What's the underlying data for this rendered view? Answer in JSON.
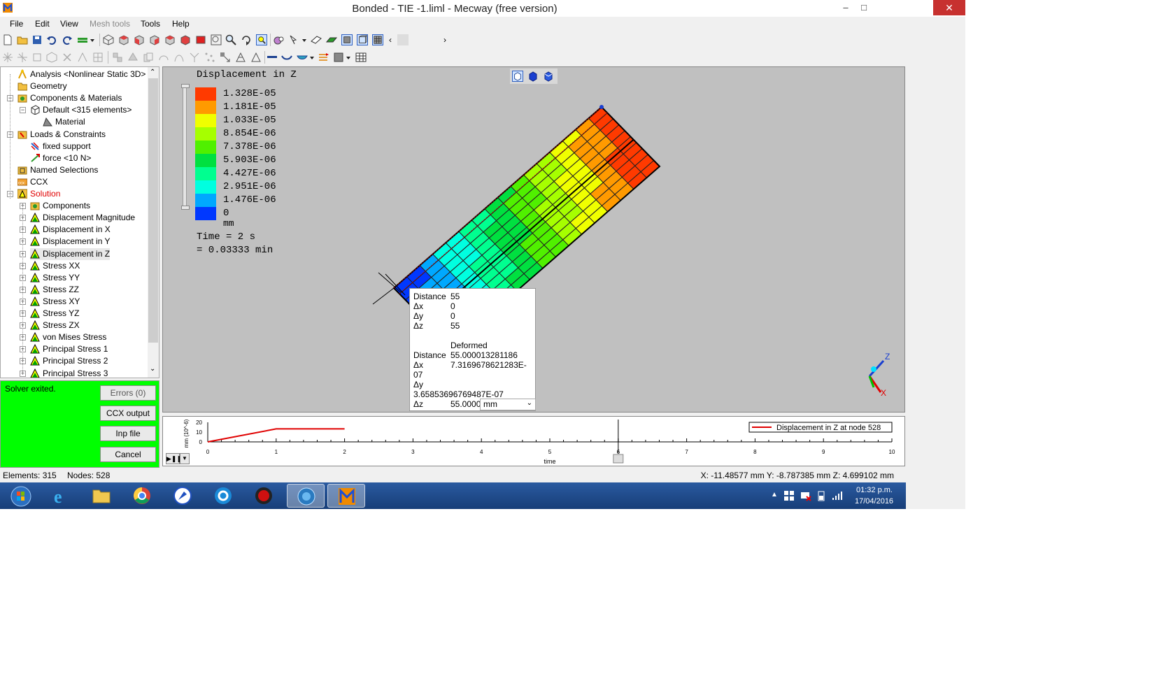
{
  "window": {
    "title": "Bonded - TIE -1.liml - Mecway (free version)",
    "controls": {
      "minimize": "–",
      "maximize": "□",
      "close": "✕"
    }
  },
  "menu": [
    {
      "label": "File",
      "enabled": true
    },
    {
      "label": "Edit",
      "enabled": true
    },
    {
      "label": "View",
      "enabled": true
    },
    {
      "label": "Mesh tools",
      "enabled": false
    },
    {
      "label": "Tools",
      "enabled": true
    },
    {
      "label": "Help",
      "enabled": true
    }
  ],
  "tree": {
    "items": [
      {
        "label": "Analysis <Nonlinear Static 3D>",
        "icon": "analysis-icon",
        "color": "#000"
      },
      {
        "label": "Geometry",
        "icon": "folder-icon",
        "color": "#000"
      },
      {
        "label": "Components & Materials",
        "icon": "components-icon",
        "color": "#000"
      },
      {
        "label": "Default <315 elements>",
        "icon": "mesh-icon",
        "color": "#000"
      },
      {
        "label": "Material",
        "icon": "material-icon",
        "color": "#000"
      },
      {
        "label": "Loads & Constraints",
        "icon": "loads-icon",
        "color": "#000"
      },
      {
        "label": "fixed support",
        "icon": "fixed-support-icon",
        "color": "#000"
      },
      {
        "label": "force <10 N>",
        "icon": "force-icon",
        "color": "#000"
      },
      {
        "label": "Named Selections",
        "icon": "named-selections-icon",
        "color": "#000"
      },
      {
        "label": "CCX",
        "icon": "ccx-icon",
        "color": "#000"
      },
      {
        "label": "Solution",
        "icon": "solution-icon",
        "color": "#e00000"
      },
      {
        "label": "Components",
        "icon": "components-icon",
        "color": "#000"
      },
      {
        "label": "Displacement Magnitude",
        "icon": "result-icon",
        "color": "#000"
      },
      {
        "label": "Displacement in X",
        "icon": "result-icon",
        "color": "#000"
      },
      {
        "label": "Displacement in Y",
        "icon": "result-icon",
        "color": "#000"
      },
      {
        "label": "Displacement in Z",
        "icon": "result-icon",
        "color": "#000"
      },
      {
        "label": "Stress XX",
        "icon": "result-icon",
        "color": "#000"
      },
      {
        "label": "Stress YY",
        "icon": "result-icon",
        "color": "#000"
      },
      {
        "label": "Stress ZZ",
        "icon": "result-icon",
        "color": "#000"
      },
      {
        "label": "Stress XY",
        "icon": "result-icon",
        "color": "#000"
      },
      {
        "label": "Stress YZ",
        "icon": "result-icon",
        "color": "#000"
      },
      {
        "label": "Stress ZX",
        "icon": "result-icon",
        "color": "#000"
      },
      {
        "label": "von Mises Stress",
        "icon": "result-icon",
        "color": "#000"
      },
      {
        "label": "Principal Stress 1",
        "icon": "result-icon",
        "color": "#000"
      },
      {
        "label": "Principal Stress 2",
        "icon": "result-icon",
        "color": "#000"
      },
      {
        "label": "Principal Stress 3",
        "icon": "result-icon",
        "color": "#000"
      }
    ]
  },
  "solver": {
    "status": "Solver exited.",
    "buttons": {
      "errors": "Errors (0)",
      "ccx_output": "CCX output",
      "inp_file": "Inp file",
      "cancel": "Cancel"
    }
  },
  "legend": {
    "title": "Displacement in Z",
    "levels": [
      {
        "label": "1.328E-05",
        "color": "#ff3a00"
      },
      {
        "label": "1.181E-05",
        "color": "#ff9a00"
      },
      {
        "label": "1.033E-05",
        "color": "#f0ff00"
      },
      {
        "label": "8.854E-06",
        "color": "#a6ff00"
      },
      {
        "label": "7.378E-06",
        "color": "#50f000"
      },
      {
        "label": "5.903E-06",
        "color": "#00e040"
      },
      {
        "label": "4.427E-06",
        "color": "#00ff90"
      },
      {
        "label": "2.951E-06",
        "color": "#00ffe0"
      },
      {
        "label": "1.476E-06",
        "color": "#00a8ff"
      },
      {
        "label": "0",
        "color": "#0038ff"
      }
    ],
    "unit": "mm",
    "time_line1": "Time = 2 s",
    "time_line2": "= 0.03333 min"
  },
  "tooltip": {
    "rows": [
      {
        "k": "Distance",
        "v": "55"
      },
      {
        "k": "Δx",
        "v": "0"
      },
      {
        "k": "Δy",
        "v": "0"
      },
      {
        "k": "Δz",
        "v": "55"
      },
      {
        "k": "",
        "v": "Deformed"
      },
      {
        "k": "Distance",
        "v": "55.000013281186"
      },
      {
        "k": "Δx",
        "v": "7.3169678621283E-"
      },
      {
        "k": "07",
        "v": ""
      },
      {
        "k": "Δy",
        "v": ""
      },
      {
        "k": "3.65853696769487E-07",
        "v": ""
      },
      {
        "k": "Δz",
        "v": "55.0000"
      }
    ],
    "unit": "mm"
  },
  "axes_triad": {
    "z": "Z",
    "x": "X"
  },
  "graph": {
    "legend": "Displacement in Z at node 528",
    "ylabel": "mm (10^-6)",
    "xlabel": "time",
    "y_ticks": [
      "20",
      "10",
      "0"
    ],
    "x_ticks": [
      "0",
      "1",
      "2",
      "3",
      "4",
      "5",
      "6",
      "7",
      "8",
      "9",
      "10"
    ],
    "line_color": "#e00000",
    "time_cursor": 6
  },
  "chart_data": {
    "type": "line",
    "title": "",
    "xlabel": "time",
    "ylabel": "mm (10^-6)",
    "xlim": [
      0,
      10
    ],
    "ylim": [
      0,
      20
    ],
    "series": [
      {
        "name": "Displacement in Z at node 528",
        "x": [
          0,
          1,
          2
        ],
        "y": [
          0,
          13.28,
          13.28
        ]
      }
    ]
  },
  "status": {
    "elements": "Elements: 315",
    "nodes": "Nodes: 528",
    "coords": "X: -11.48577 mm Y: -8.787385 mm Z: 4.699102 mm"
  },
  "taskbar": {
    "apps": [
      "start",
      "internet-explorer",
      "file-explorer",
      "chrome",
      "app-blue",
      "app-c",
      "app-red",
      "app-globe",
      "mecway"
    ],
    "time": "01:32 p.m.",
    "date": "17/04/2016"
  }
}
